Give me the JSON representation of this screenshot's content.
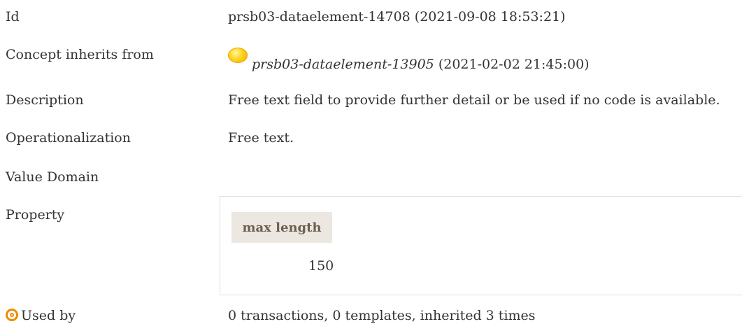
{
  "rows": {
    "id": {
      "label": "Id",
      "value": "prsb03-dataelement-14708 (2021-09-08 18:53:21)"
    },
    "inherits": {
      "label": "Concept inherits from",
      "link": "prsb03-dataelement-13905",
      "date": " (2021-02-02 21:45:00)"
    },
    "description": {
      "label": "Description",
      "value": "Free text field to provide further detail or be used if no code is available."
    },
    "operationalization": {
      "label": "Operationalization",
      "value": "Free text."
    },
    "value_domain": {
      "label": "Value Domain"
    },
    "property": {
      "label": "Property",
      "header": "max length",
      "value": "150"
    },
    "used_by": {
      "label": "Used by",
      "value": "0 transactions, 0 templates, inherited 3 times"
    }
  },
  "icons": {
    "inherits_icon": "yellow-orb-icon",
    "used_by_icon": "target-icon"
  },
  "colors": {
    "accent_orange": "#f08a00",
    "header_bg": "#ece8e1",
    "header_text": "#6b5f4e"
  }
}
